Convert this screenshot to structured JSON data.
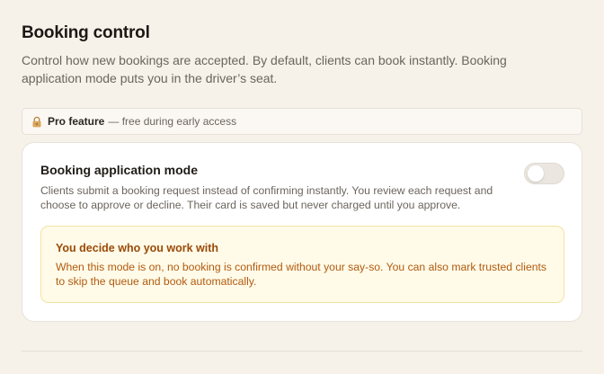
{
  "header": {
    "title": "Booking control",
    "subtitle": "Control how new bookings are accepted. By default, clients can book instantly. Booking application mode puts you in the driver’s seat."
  },
  "pro_banner": {
    "icon": "lock-icon",
    "strong": "Pro feature",
    "text": "— free during early access"
  },
  "mode": {
    "title": "Booking application mode",
    "description": "Clients submit a booking request instead of confirming instantly. You review each request and choose to approve or decline. Their card is saved but never charged until you approve.",
    "enabled": false
  },
  "notice": {
    "title": "You decide who you work with",
    "body": "When this mode is on, no booking is confirmed without your say-so. You can also mark trusted clients to skip the queue and book automatically."
  },
  "colors": {
    "background": "#f6f1e9",
    "card": "#ffffff",
    "notice_bg": "#fffbe8",
    "notice_title": "#9a4a08",
    "notice_text": "#b25a0f",
    "toggle_off": "#ebe6df"
  }
}
